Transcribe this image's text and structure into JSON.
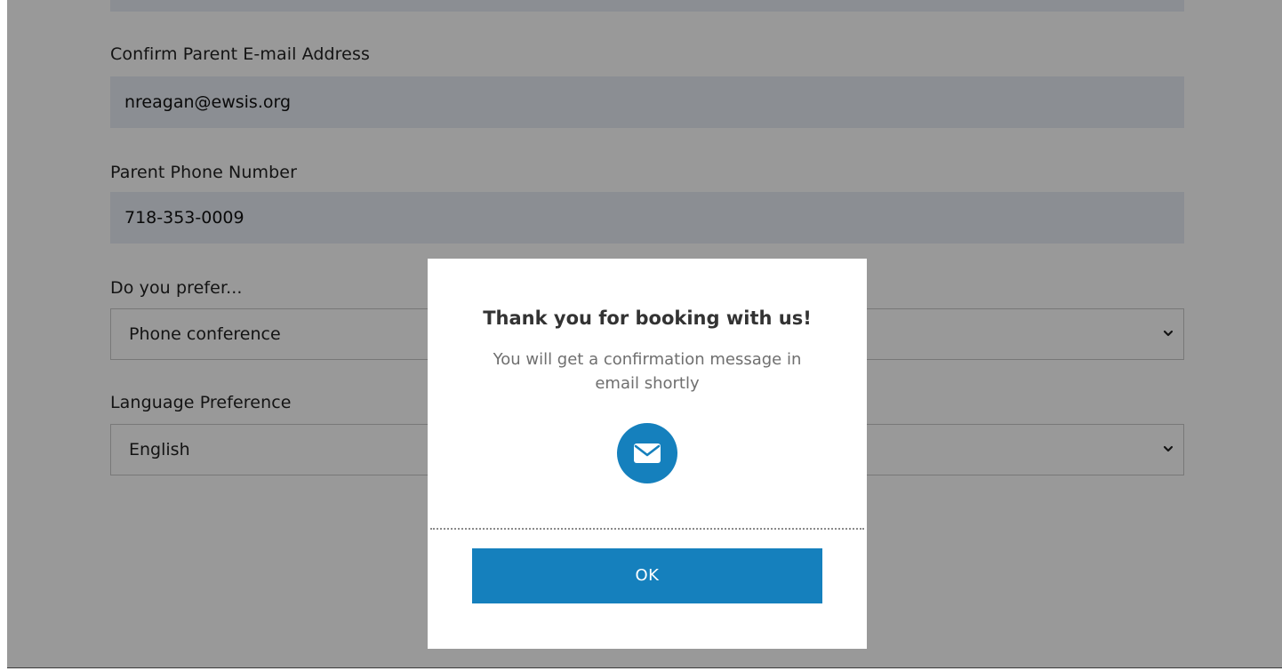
{
  "form": {
    "confirm_email": {
      "label": "Confirm Parent E-mail Address",
      "value": "nreagan@ewsis.org"
    },
    "phone": {
      "label": "Parent Phone Number",
      "value": "718-353-0009"
    },
    "meeting_preference": {
      "label": "Do you prefer...",
      "selected": "Phone conference"
    },
    "language_preference": {
      "label": "Language Preference",
      "selected": "English"
    }
  },
  "modal": {
    "title": "Thank you for booking with us!",
    "message": "You will get a confirmation message in email shortly",
    "icon": "envelope-icon",
    "ok_label": "OK"
  },
  "colors": {
    "accent": "#1580bd",
    "input_bg": "#e8edf6",
    "overlay": "rgba(0,0,0,0.40)"
  }
}
